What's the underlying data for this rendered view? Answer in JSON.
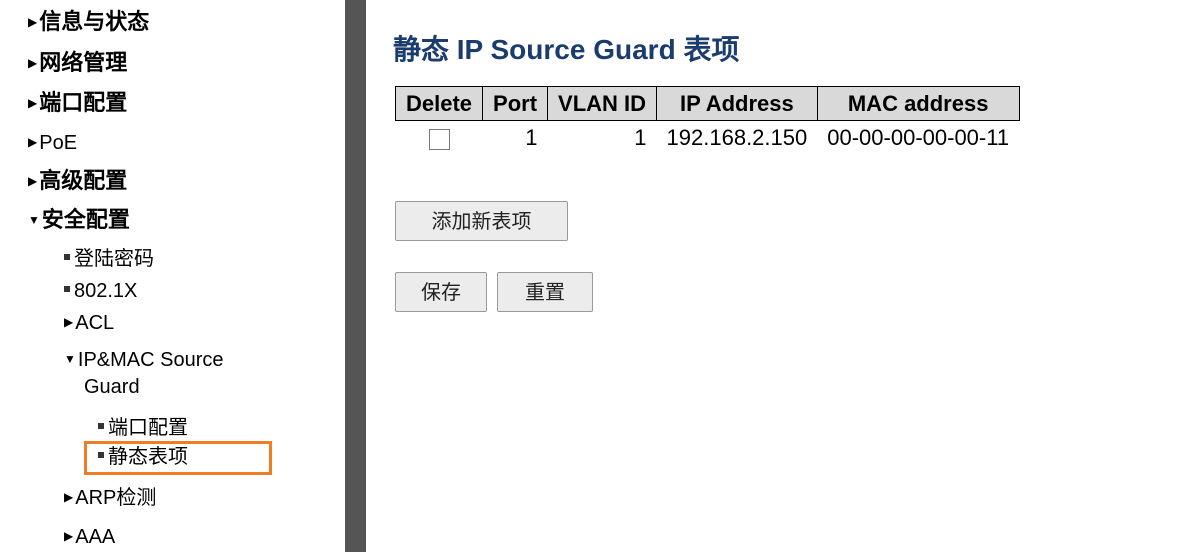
{
  "sidebar": {
    "items": [
      {
        "label": "信息与状态"
      },
      {
        "label": "网络管理"
      },
      {
        "label": "端口配置"
      },
      {
        "label": "PoE"
      },
      {
        "label": "高级配置"
      },
      {
        "label": "安全配置"
      },
      {
        "label": "登陆密码"
      },
      {
        "label": "802.1X"
      },
      {
        "label": "ACL"
      },
      {
        "label": "IP&MAC Source"
      },
      {
        "label": "Guard"
      },
      {
        "label": "端口配置"
      },
      {
        "label": "静态表项"
      },
      {
        "label": "ARP检测"
      },
      {
        "label": "AAA"
      }
    ]
  },
  "main": {
    "title": "静态 IP Source Guard 表项",
    "table": {
      "headers": [
        "Delete",
        "Port",
        "VLAN ID",
        "IP Address",
        "MAC address"
      ],
      "rows": [
        {
          "delete": false,
          "port": "1",
          "vlan_id": "1",
          "ip": "192.168.2.150",
          "mac": "00-00-00-00-00-11"
        }
      ]
    },
    "buttons": {
      "add": "添加新表项",
      "save": "保存",
      "reset": "重置"
    }
  },
  "colors": {
    "title": "#1a3c6e",
    "highlight": "#f07d24",
    "divider": "#555555",
    "header_bg": "#d9d9d9"
  }
}
